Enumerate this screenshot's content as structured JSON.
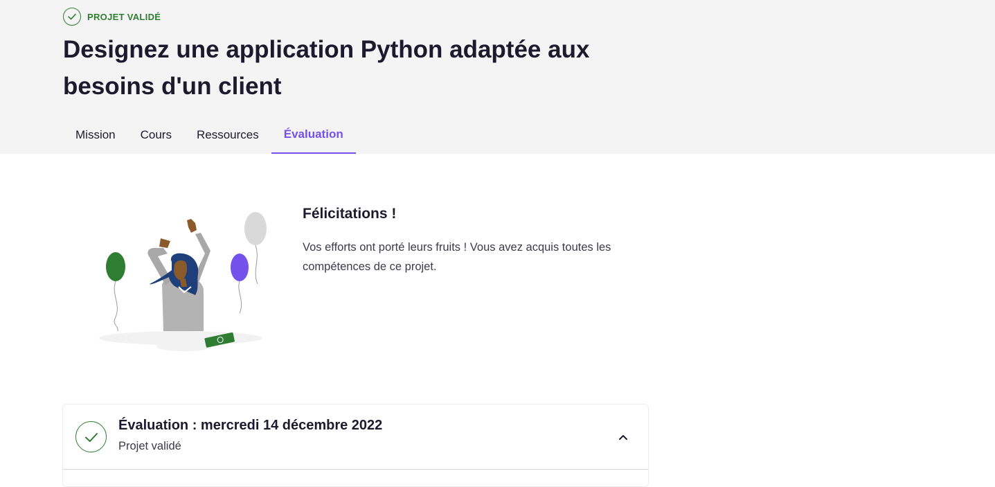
{
  "header": {
    "status_label": "PROJET VALIDÉ",
    "status_icon": "check-circle-icon",
    "title": "Designez une application Python adaptée aux besoins d'un client"
  },
  "tabs": [
    {
      "label": "Mission",
      "active": false
    },
    {
      "label": "Cours",
      "active": false
    },
    {
      "label": "Ressources",
      "active": false
    },
    {
      "label": "Évaluation",
      "active": true
    }
  ],
  "congrats": {
    "title": "Félicitations !",
    "text": "Vos efforts ont porté leurs fruits ! Vous avez acquis toutes les compétences de ce projet.",
    "illustration": "celebrating-woman-with-balloons"
  },
  "evaluation": {
    "title": "Évaluation : mercredi 14 décembre 2022",
    "subtitle": "Projet validé",
    "icon": "check-circle-icon",
    "toggle_icon": "chevron-up-icon",
    "expanded": true
  },
  "colors": {
    "accent": "#7451eb",
    "success": "#2e7d32",
    "header_bg": "#f4f4f4",
    "text": "#1d1a2e"
  }
}
